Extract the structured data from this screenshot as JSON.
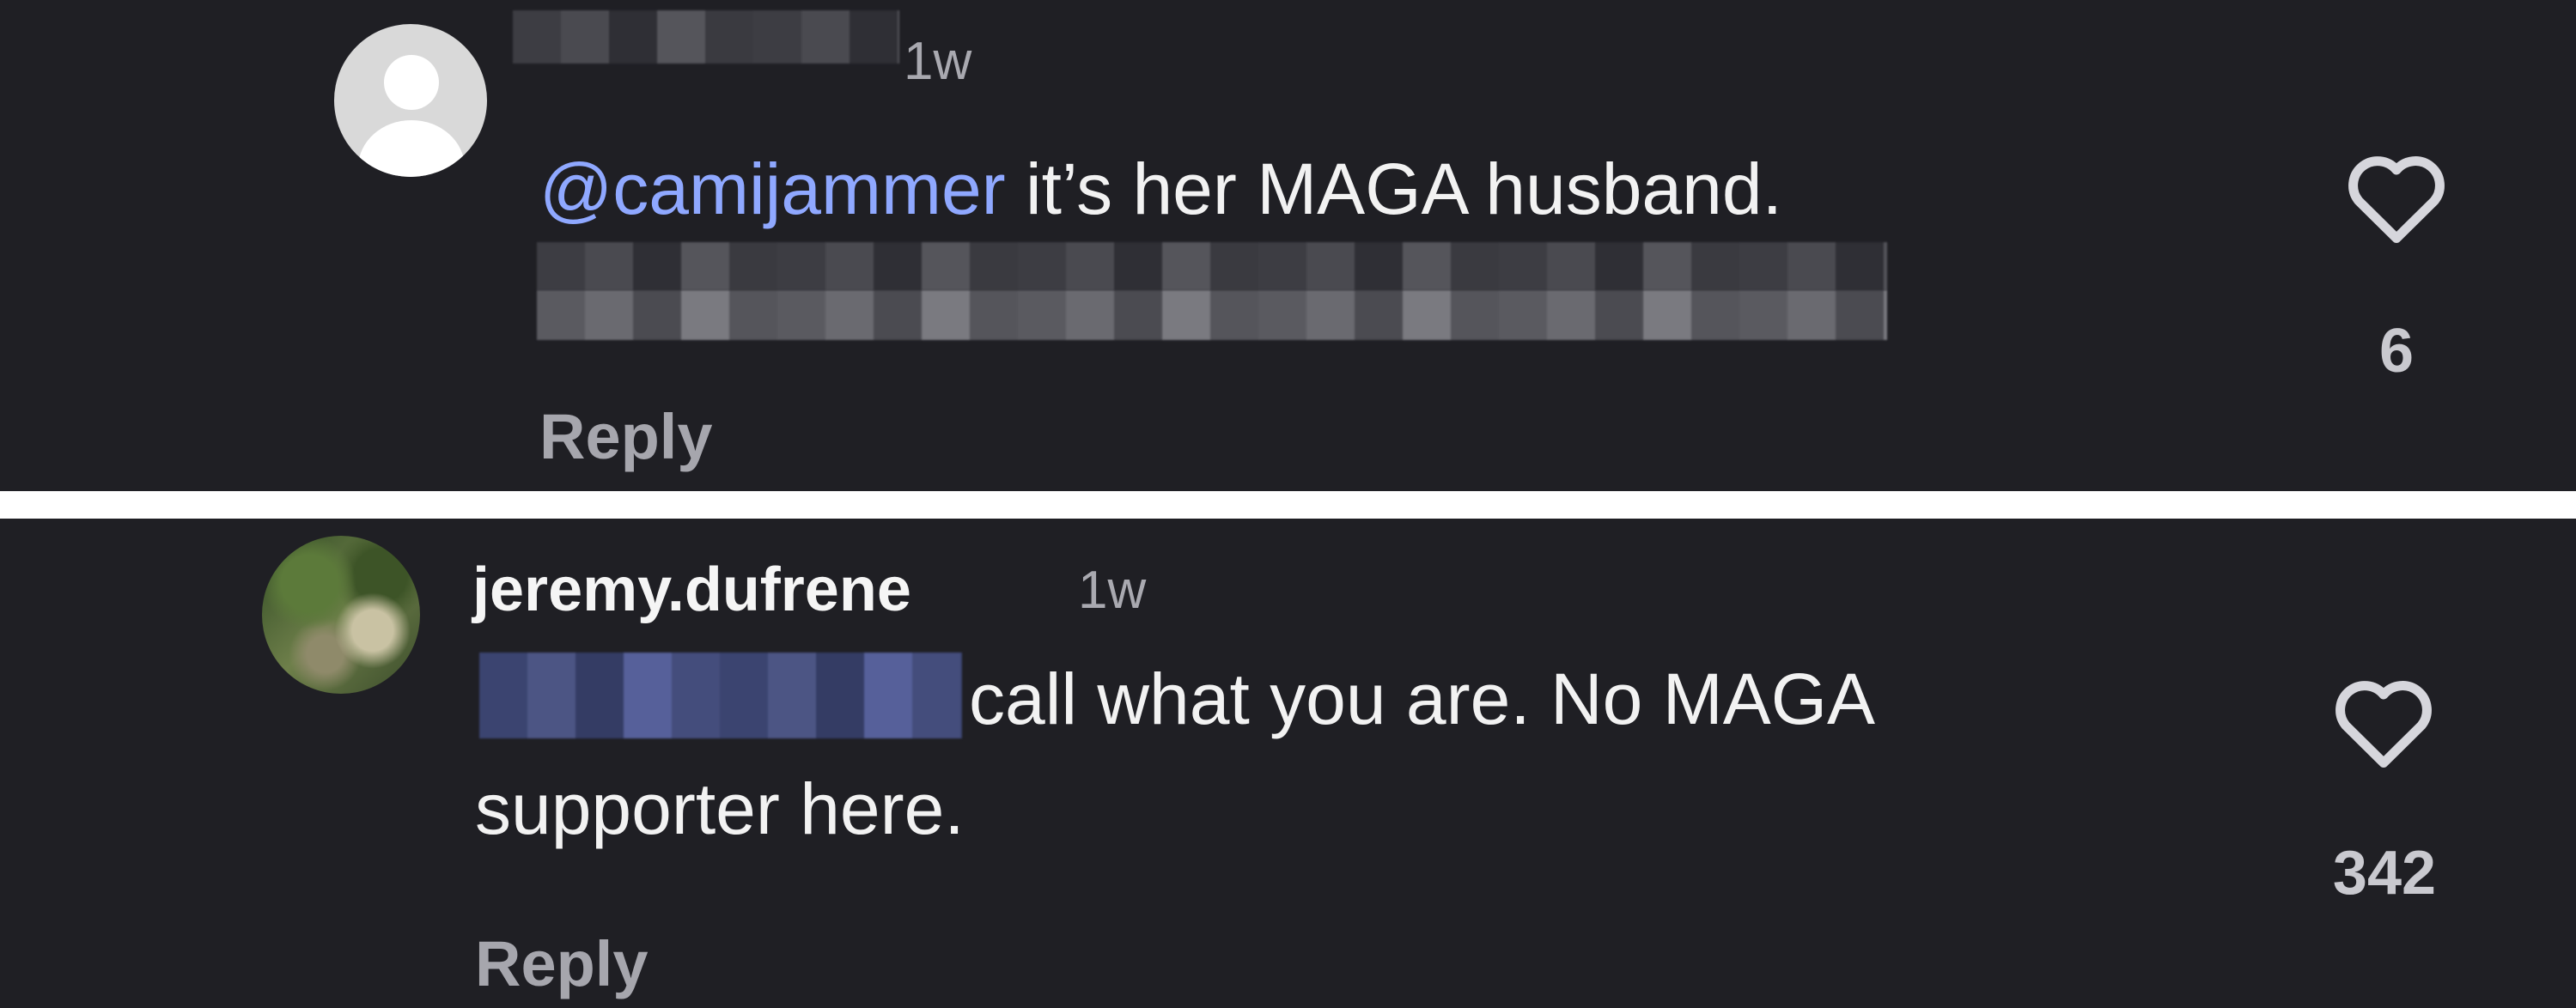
{
  "comments": [
    {
      "username": "",
      "timestamp": "1w",
      "mention": "@camijammer",
      "text": " it’s her MAGA husband.",
      "reply_label": "Reply",
      "likes": "6",
      "icons": {
        "avatar": "default-avatar-icon",
        "like": "heart-icon"
      }
    },
    {
      "username": "jeremy.dufrene",
      "timestamp": "1w",
      "line1": "call what you are. No MAGA",
      "line2": "supporter here.",
      "reply_label": "Reply",
      "likes": "342",
      "icons": {
        "avatar": "profile-photo-avatar",
        "like": "heart-icon"
      }
    }
  ],
  "colors": {
    "background": "#1f1f24",
    "divider": "#ffffff",
    "mention": "#8fa8ff",
    "secondary_text": "#a9a9b0"
  }
}
